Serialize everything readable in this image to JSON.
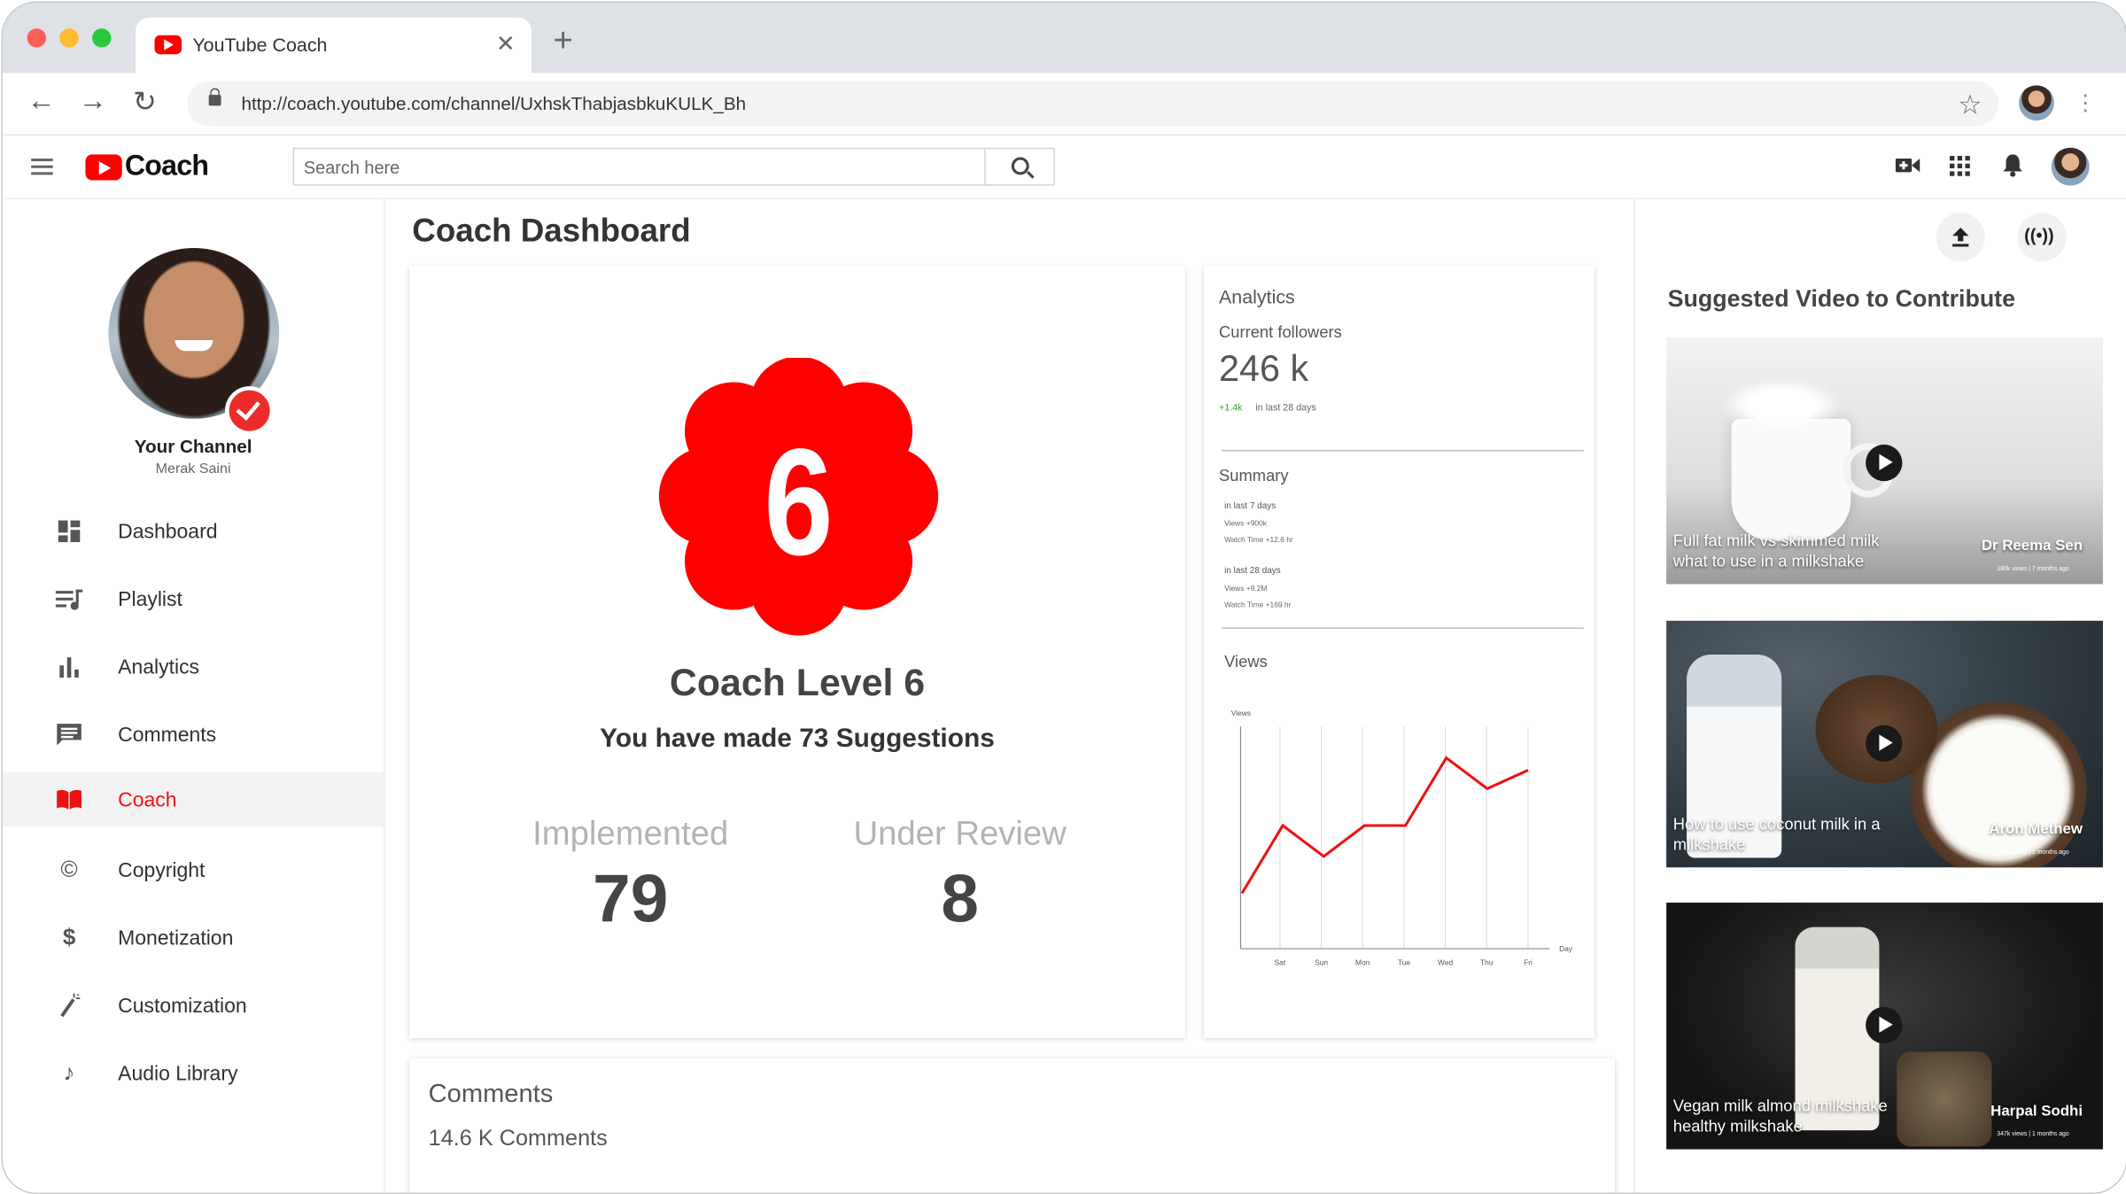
{
  "browser": {
    "tab_title": "YouTube Coach",
    "url": "http://coach.youtube.com/channel/UxhskThabjasbkuKULK_Bh"
  },
  "header": {
    "logo_text": "Coach",
    "search_placeholder": "Search here"
  },
  "sidebar": {
    "channel_name": "Your Channel",
    "channel_user": "Merak Saini",
    "items": [
      {
        "label": "Dashboard",
        "icon": "dashboard-icon"
      },
      {
        "label": "Playlist",
        "icon": "playlist-icon"
      },
      {
        "label": "Analytics",
        "icon": "analytics-icon"
      },
      {
        "label": "Comments",
        "icon": "comments-icon"
      },
      {
        "label": "Coach",
        "icon": "book-icon",
        "active": true
      },
      {
        "label": "Copyright",
        "icon": "copyright-icon"
      },
      {
        "label": "Monetization",
        "icon": "dollar-icon"
      },
      {
        "label": "Customization",
        "icon": "wand-icon"
      },
      {
        "label": "Audio Library",
        "icon": "music-note-icon"
      }
    ]
  },
  "main": {
    "page_title": "Coach Dashboard",
    "coach": {
      "level_number": "6",
      "level_text": "Coach Level 6",
      "suggestions_text": "You have made 73 Suggestions",
      "implemented_label": "Implemented",
      "implemented_value": "79",
      "review_label": "Under Review",
      "review_value": "8"
    },
    "analytics": {
      "title": "Analytics",
      "followers_label": "Current followers",
      "followers_value": "246 k",
      "followers_delta": "+1.4k",
      "followers_delta_note": "in last 28 days",
      "summary_title": "Summary",
      "summary_7_title": "in last 7 days",
      "summary_7_views": "Views   +900k",
      "summary_7_watch": "Watch Time   +12.6 hr",
      "summary_28_title": "in last 28 days",
      "summary_28_views": "Views   +9.2M",
      "summary_28_watch": "Watch Time   +169 hr",
      "views_title": "Views"
    },
    "comments": {
      "title": "Comments",
      "count": "14.6 K Comments"
    }
  },
  "chart_data": {
    "type": "line",
    "ylabel": "Views",
    "xlabel": "Day",
    "categories": [
      "Sat",
      "Sun",
      "Mon",
      "Tue",
      "Wed",
      "Thu",
      "Fri"
    ],
    "values": [
      1.8,
      4.0,
      3.0,
      4.0,
      4.0,
      6.2,
      5.2,
      5.8
    ],
    "note": "y-axis has no tick values; values are relative heights",
    "color": "#ee1111"
  },
  "right_panel": {
    "title": "Suggested Video to Contribute",
    "videos": [
      {
        "title": "Full fat milk vs skimmed milk what to use in a milkshake",
        "author": "Dr Reema Sen",
        "meta": "180k views | 7 months ago"
      },
      {
        "title": "How to use coconut milk in a milkshake",
        "author": "Aron Methew",
        "meta": "140k views | 2 months ago"
      },
      {
        "title": "Vegan milk almond milkshake healthy milkshake",
        "author": "Harpal Sodhi",
        "meta": "347k views | 1 months ago"
      }
    ]
  },
  "colors": {
    "accent": "#ee1111",
    "youtube_red": "#ff0000"
  }
}
